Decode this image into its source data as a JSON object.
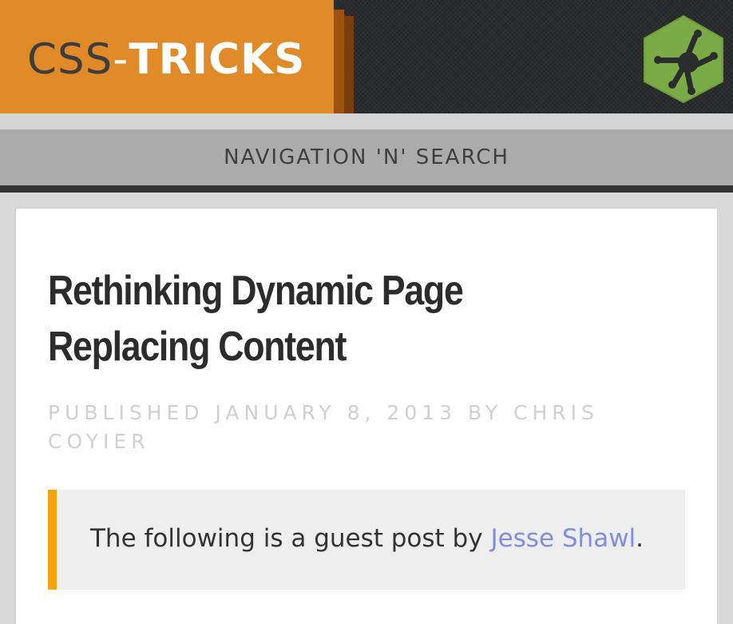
{
  "header": {
    "logo": {
      "part1": "CSS",
      "part2": "-",
      "part3": "TRICKS"
    },
    "badge_icon": "frog-hexagon-icon"
  },
  "nav": {
    "label": "NAVIGATION 'N' SEARCH"
  },
  "article": {
    "title": "Rethinking Dynamic Page Replacing Content",
    "meta": {
      "published_prefix": "PUBLISHED",
      "date": "JANUARY 8, 2013",
      "by_prefix": "BY",
      "author": "CHRIS COYIER"
    },
    "note": {
      "text_before": "The following is a guest post by ",
      "link_text": "Jesse Shawl",
      "text_after": "."
    }
  },
  "colors": {
    "brand_orange": "#e08a28",
    "accent_yellow": "#f4a20d",
    "link_blue": "#7f8ee3",
    "badge_green": "#7bab46"
  }
}
